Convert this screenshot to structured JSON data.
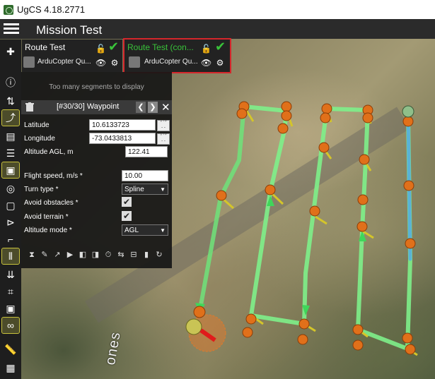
{
  "app": {
    "title": "UgCS 4.18.2771"
  },
  "header": {
    "mission_title": "Mission Test"
  },
  "routes": [
    {
      "name": "Route Test",
      "drone": "ArduCopter Qu...",
      "selected": false
    },
    {
      "name": "Route Test (con...",
      "drone": "ArduCopter Qu...",
      "selected": true
    }
  ],
  "panel": {
    "notice": "Too many segments to display",
    "waypoint_title": "[#30/30] Waypoint",
    "fields": {
      "latitude_label": "Latitude",
      "latitude": "10.6133723",
      "longitude_label": "Longitude",
      "longitude": "-73.0433813",
      "altitude_label": "Altitude AGL, m",
      "altitude": "122.41",
      "speed_label": "Flight speed, m/s *",
      "speed": "10.00",
      "turn_label": "Turn type *",
      "turn": "Spline",
      "avoid_obstacles_label": "Avoid obstacles *",
      "avoid_terrain_label": "Avoid terrain *",
      "alt_mode_label": "Altitude mode *",
      "alt_mode": "AGL"
    }
  },
  "map": {
    "road_label": "ones"
  },
  "colors": {
    "accent": "#39c33a",
    "selected_outline": "#d6262b",
    "waypoint": "#e0701a",
    "route": "#6fe37a"
  }
}
